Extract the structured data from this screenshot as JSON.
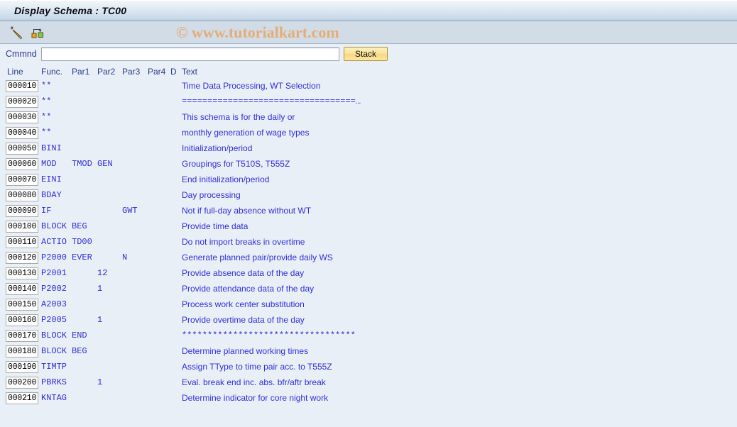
{
  "window": {
    "title": "Display Schema : TC00"
  },
  "toolbar": {
    "buttons": [
      {
        "name": "edit-schema-icon",
        "label": ""
      },
      {
        "name": "structure-navigate-icon",
        "label": ""
      }
    ],
    "watermark": "© www.tutorialkart.com"
  },
  "command": {
    "label": "Cmmnd",
    "value": "",
    "placeholder": "",
    "stack_label": "Stack"
  },
  "table": {
    "headers": [
      "Line",
      "Func.",
      "Par1",
      "Par2",
      "Par3",
      "Par4",
      "D",
      "Text"
    ],
    "rows": [
      {
        "line": "000010",
        "func": "**",
        "par1": "",
        "par2": "",
        "par3": "",
        "par4": "",
        "d": "",
        "text": "Time Data Processing, WT Selection",
        "mono": false
      },
      {
        "line": "000020",
        "func": "**",
        "par1": "",
        "par2": "",
        "par3": "",
        "par4": "",
        "d": "",
        "text": "==================================…",
        "mono": true
      },
      {
        "line": "000030",
        "func": "**",
        "par1": "",
        "par2": "",
        "par3": "",
        "par4": "",
        "d": "",
        "text": "This schema is for the daily or",
        "mono": false
      },
      {
        "line": "000040",
        "func": "**",
        "par1": "",
        "par2": "",
        "par3": "",
        "par4": "",
        "d": "",
        "text": "monthly generation of wage types",
        "mono": false
      },
      {
        "line": "000050",
        "func": "BINI",
        "par1": "",
        "par2": "",
        "par3": "",
        "par4": "",
        "d": "",
        "text": "Initialization/period",
        "mono": false
      },
      {
        "line": "000060",
        "func": "MOD",
        "par1": "TMOD",
        "par2": "GEN",
        "par3": "",
        "par4": "",
        "d": "",
        "text": "Groupings for T510S, T555Z",
        "mono": false
      },
      {
        "line": "000070",
        "func": "EINI",
        "par1": "",
        "par2": "",
        "par3": "",
        "par4": "",
        "d": "",
        "text": "End initialization/period",
        "mono": false
      },
      {
        "line": "000080",
        "func": "BDAY",
        "par1": "",
        "par2": "",
        "par3": "",
        "par4": "",
        "d": "",
        "text": "Day processing",
        "mono": false
      },
      {
        "line": "000090",
        "func": "IF",
        "par1": "",
        "par2": "",
        "par3": "GWT",
        "par4": "",
        "d": "",
        "text": "Not if full-day absence without WT",
        "mono": false
      },
      {
        "line": "000100",
        "func": "BLOCK",
        "par1": "BEG",
        "par2": "",
        "par3": "",
        "par4": "",
        "d": "",
        "text": "Provide time data",
        "mono": false
      },
      {
        "line": "000110",
        "func": "ACTIO",
        "par1": "TD00",
        "par2": "",
        "par3": "",
        "par4": "",
        "d": "",
        "text": "Do not import breaks in overtime",
        "mono": false
      },
      {
        "line": "000120",
        "func": "P2000",
        "par1": "EVER",
        "par2": "",
        "par3": "N",
        "par4": "",
        "d": "",
        "text": "Generate planned pair/provide daily WS",
        "mono": false
      },
      {
        "line": "000130",
        "func": "P2001",
        "par1": "",
        "par2": "12",
        "par3": "",
        "par4": "",
        "d": "",
        "text": "Provide absence data of the day",
        "mono": false
      },
      {
        "line": "000140",
        "func": "P2002",
        "par1": "",
        "par2": "1",
        "par3": "",
        "par4": "",
        "d": "",
        "text": "Provide attendance data of the day",
        "mono": false
      },
      {
        "line": "000150",
        "func": "A2003",
        "par1": "",
        "par2": "",
        "par3": "",
        "par4": "",
        "d": "",
        "text": "Process work center substitution",
        "mono": false
      },
      {
        "line": "000160",
        "func": "P2005",
        "par1": "",
        "par2": "1",
        "par3": "",
        "par4": "",
        "d": "",
        "text": "Provide overtime data of the day",
        "mono": false
      },
      {
        "line": "000170",
        "func": "BLOCK",
        "par1": "END",
        "par2": "",
        "par3": "",
        "par4": "",
        "d": "",
        "text": "**********************************",
        "mono": true
      },
      {
        "line": "000180",
        "func": "BLOCK",
        "par1": "BEG",
        "par2": "",
        "par3": "",
        "par4": "",
        "d": "",
        "text": "Determine planned working times",
        "mono": false
      },
      {
        "line": "000190",
        "func": "TIMTP",
        "par1": "",
        "par2": "",
        "par3": "",
        "par4": "",
        "d": "",
        "text": "Assign TType to time pair acc. to T555Z",
        "mono": false
      },
      {
        "line": "000200",
        "func": "PBRKS",
        "par1": "",
        "par2": "1",
        "par3": "",
        "par4": "",
        "d": "",
        "text": "Eval. break end inc. abs. bfr/aftr break",
        "mono": false
      },
      {
        "line": "000210",
        "func": "KNTAG",
        "par1": "",
        "par2": "",
        "par3": "",
        "par4": "",
        "d": "",
        "text": "Determine indicator for core night work",
        "mono": false
      }
    ]
  },
  "colors": {
    "title_bar_top": "#f2f6fa",
    "title_bar_bottom": "#b0c6da",
    "toolbar_bg": "#d2dce6",
    "body_bg": "#e9eff7",
    "text_blue": "#2f2fd8",
    "label_blue": "#2b3a8f",
    "watermark": "#e3ad77",
    "stack_button": "#fae39a"
  }
}
